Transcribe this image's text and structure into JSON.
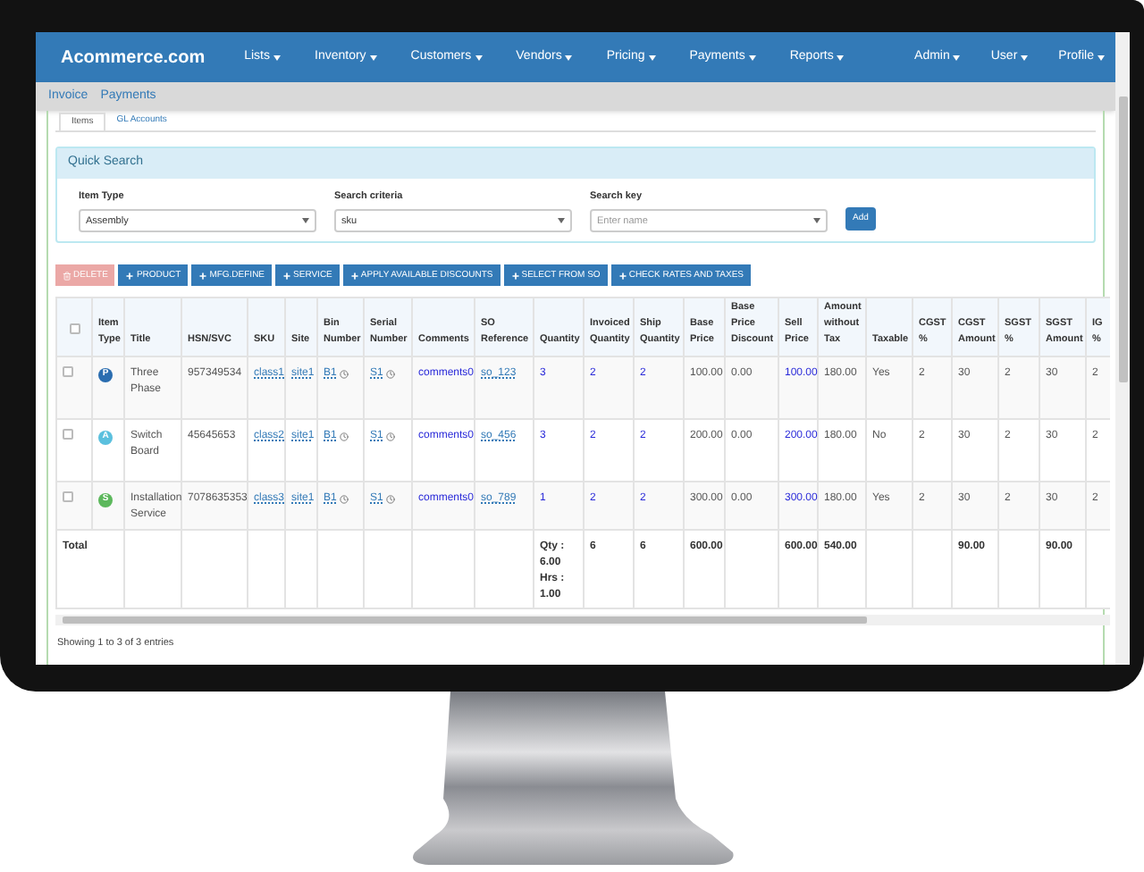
{
  "brand": "Acommerce.com",
  "nav_left": [
    "Lists",
    "Inventory",
    "Customers",
    "Vendors",
    "Pricing",
    "Payments",
    "Reports"
  ],
  "nav_right": [
    "Admin",
    "User",
    "Profile"
  ],
  "subnav": [
    "Invoice",
    "Payments"
  ],
  "tabs": [
    {
      "label": "Items",
      "selected": true
    },
    {
      "label": "GL Accounts",
      "selected": false
    }
  ],
  "quick_search": {
    "title": "Quick Search",
    "fields": [
      {
        "label": "Item Type",
        "value": "Assembly"
      },
      {
        "label": "Search criteria",
        "value": "sku"
      },
      {
        "label": "Search key",
        "placeholder": "Enter name"
      }
    ],
    "button": "Add"
  },
  "toolbar": [
    {
      "label": "DELETE",
      "kind": "danger",
      "disabled": true
    },
    {
      "label": "PRODUCT",
      "kind": "add",
      "disabled": false
    },
    {
      "label": "MFG.DEFINE",
      "kind": "add",
      "disabled": false
    },
    {
      "label": "SERVICE",
      "kind": "add",
      "disabled": false
    },
    {
      "label": "APPLY AVAILABLE DISCOUNTS",
      "kind": "add",
      "disabled": false
    },
    {
      "label": "SELECT FROM SO",
      "kind": "add",
      "disabled": false
    },
    {
      "label": "CHECK RATES AND TAXES",
      "kind": "add",
      "disabled": false
    }
  ],
  "table": {
    "select_all_checked": false,
    "columns": [
      "Item Type",
      "Title",
      "HSN/SVC",
      "SKU",
      "Site",
      "Bin Number",
      "Serial Number",
      "Comments",
      "SO Reference",
      "Quantity",
      "Invoiced Quantity",
      "Ship Quantity",
      "Base Price",
      "Base Price Discount",
      "Sell Price",
      "Amount without Tax",
      "Taxable",
      "CGST %",
      "CGST Amount",
      "SGST %",
      "SGST Amount",
      "IG %"
    ],
    "rows": [
      {
        "checked": false,
        "type_letter": "P",
        "color": "#2a6db0",
        "title": "Three Phase",
        "hsn": "957349534",
        "sku": "class1",
        "site": "site1",
        "bin": "B1",
        "serial": "S1",
        "comments": "comments0",
        "so_ref": "so_123",
        "quantity": "3",
        "invoiced_quantity": "2",
        "ship_quantity": "2",
        "base_price": "100.00",
        "base_price_discount": "0.00",
        "sell_price": "100.00",
        "amount_without_tax": "180.00",
        "taxable": "Yes",
        "cgst_pct": "2",
        "cgst_amount": "30",
        "sgst_pct": "2",
        "sgst_amount": "30",
        "ig_pct": "2"
      },
      {
        "checked": false,
        "type_letter": "A",
        "color": "#5bc0de",
        "title": "Switch Board",
        "hsn": "45645653",
        "sku": "class2",
        "site": "site1",
        "bin": "B1",
        "serial": "S1",
        "comments": "comments0",
        "so_ref": "so_456",
        "quantity": "3",
        "invoiced_quantity": "2",
        "ship_quantity": "2",
        "base_price": "200.00",
        "base_price_discount": "0.00",
        "sell_price": "200.00",
        "amount_without_tax": "180.00",
        "taxable": "No",
        "cgst_pct": "2",
        "cgst_amount": "30",
        "sgst_pct": "2",
        "sgst_amount": "30",
        "ig_pct": "2"
      },
      {
        "checked": false,
        "type_letter": "S",
        "color": "#5cb85c",
        "title": "Installation Service",
        "hsn": "7078635353",
        "sku": "class3",
        "site": "site1",
        "bin": "B1",
        "serial": "S1",
        "comments": "comments0",
        "so_ref": "so_789",
        "quantity": "1",
        "invoiced_quantity": "2",
        "ship_quantity": "2",
        "base_price": "300.00",
        "base_price_discount": "0.00",
        "sell_price": "300.00",
        "amount_without_tax": "180.00",
        "taxable": "Yes",
        "cgst_pct": "2",
        "cgst_amount": "30",
        "sgst_pct": "2",
        "sgst_amount": "30",
        "ig_pct": "2"
      }
    ],
    "total": {
      "label": "Total",
      "quantity": "Qty : 6.00 Hrs : 1.00",
      "invoiced_quantity": "6",
      "ship_quantity": "6",
      "base_price": "600.00",
      "sell_price": "600.00",
      "amount_without_tax": "540.00",
      "cgst_amount": "90.00",
      "sgst_amount": "90.00"
    }
  },
  "footer": "Showing 1 to 3 of 3 entries"
}
